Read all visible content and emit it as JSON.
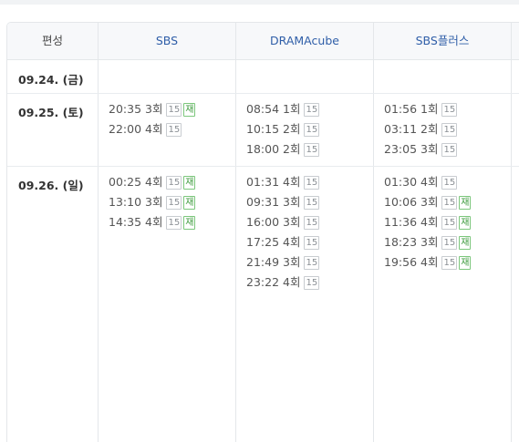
{
  "header": {
    "label": "편성",
    "channels": [
      "SBS",
      "DRAMAcube",
      "SBS플러스"
    ]
  },
  "days": [
    {
      "date": "09.24. (금)",
      "cells": [
        [],
        [],
        []
      ]
    },
    {
      "date": "09.25. (토)",
      "cells": [
        [
          {
            "time": "20:35",
            "ep": "3회",
            "age": "15",
            "re": "재"
          },
          {
            "time": "22:00",
            "ep": "4회",
            "age": "15",
            "re": ""
          }
        ],
        [
          {
            "time": "08:54",
            "ep": "1회",
            "age": "15",
            "re": ""
          },
          {
            "time": "10:15",
            "ep": "2회",
            "age": "15",
            "re": ""
          },
          {
            "time": "18:00",
            "ep": "2회",
            "age": "15",
            "re": ""
          }
        ],
        [
          {
            "time": "01:56",
            "ep": "1회",
            "age": "15",
            "re": ""
          },
          {
            "time": "03:11",
            "ep": "2회",
            "age": "15",
            "re": ""
          },
          {
            "time": "23:05",
            "ep": "3회",
            "age": "15",
            "re": ""
          }
        ]
      ]
    },
    {
      "date": "09.26. (일)",
      "cells": [
        [
          {
            "time": "00:25",
            "ep": "4회",
            "age": "15",
            "re": "재"
          },
          {
            "time": "13:10",
            "ep": "3회",
            "age": "15",
            "re": "재"
          },
          {
            "time": "14:35",
            "ep": "4회",
            "age": "15",
            "re": "재"
          }
        ],
        [
          {
            "time": "01:31",
            "ep": "4회",
            "age": "15",
            "re": ""
          },
          {
            "time": "09:31",
            "ep": "3회",
            "age": "15",
            "re": ""
          },
          {
            "time": "16:00",
            "ep": "3회",
            "age": "15",
            "re": ""
          },
          {
            "time": "17:25",
            "ep": "4회",
            "age": "15",
            "re": ""
          },
          {
            "time": "21:49",
            "ep": "3회",
            "age": "15",
            "re": ""
          },
          {
            "time": "23:22",
            "ep": "4회",
            "age": "15",
            "re": ""
          }
        ],
        [
          {
            "time": "01:30",
            "ep": "4회",
            "age": "15",
            "re": ""
          },
          {
            "time": "10:06",
            "ep": "3회",
            "age": "15",
            "re": "재"
          },
          {
            "time": "11:36",
            "ep": "4회",
            "age": "15",
            "re": "재"
          },
          {
            "time": "18:23",
            "ep": "3회",
            "age": "15",
            "re": "재"
          },
          {
            "time": "19:56",
            "ep": "4회",
            "age": "15",
            "re": "재"
          }
        ]
      ]
    }
  ]
}
